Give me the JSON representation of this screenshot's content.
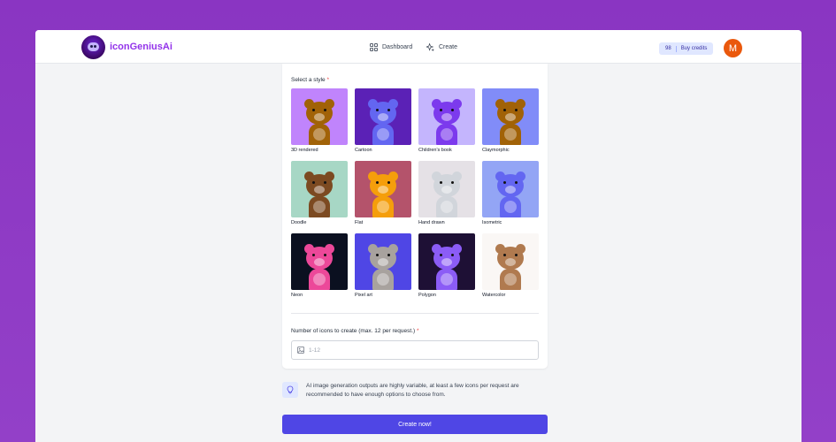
{
  "app": {
    "brand": "iconGeniusAi",
    "nav": [
      {
        "label": "Dashboard",
        "icon": "dashboard-icon"
      },
      {
        "label": "Create",
        "icon": "sparkle-icon"
      }
    ],
    "credits": {
      "count": "98",
      "label": "Buy credits"
    },
    "avatar_initial": "M"
  },
  "form": {
    "style_label": "Select a style",
    "required_mark": "*",
    "styles": [
      {
        "label": "3D rendered",
        "bg": "#c084fc",
        "bear": "#a16207"
      },
      {
        "label": "Cartoon",
        "bg": "#5b21b6",
        "bear": "#6366f1"
      },
      {
        "label": "Children's book",
        "bg": "#c4b5fd",
        "bear": "#7c3aed"
      },
      {
        "label": "Claymorphic",
        "bg": "#818cf8",
        "bear": "#a16207"
      },
      {
        "label": "Doodle",
        "bg": "#a7d7c5",
        "bear": "#7c4a21"
      },
      {
        "label": "Flat",
        "bg": "#b4536b",
        "bear": "#f59e0b"
      },
      {
        "label": "Hand drawn",
        "bg": "#e5e1e6",
        "bear": "#d1d5db"
      },
      {
        "label": "Isometric",
        "bg": "#93a5f5",
        "bear": "#6366f1"
      },
      {
        "label": "Neon",
        "bg": "#0b1020",
        "bear": "#ec4899"
      },
      {
        "label": "Pixel art",
        "bg": "#4f46e5",
        "bear": "#a8a29e"
      },
      {
        "label": "Polygon",
        "bg": "#1e1035",
        "bear": "#8b5cf6"
      },
      {
        "label": "Watercolor",
        "bg": "#faf7f5",
        "bear": "#b07a4f"
      }
    ],
    "count_label": "Number of icons to create (max. 12 per request.)",
    "count_placeholder": "1-12",
    "tip": "AI image generation outputs are highly variable, at least a few icons per request are recommended to have enough options to choose from.",
    "submit_label": "Create now!"
  }
}
